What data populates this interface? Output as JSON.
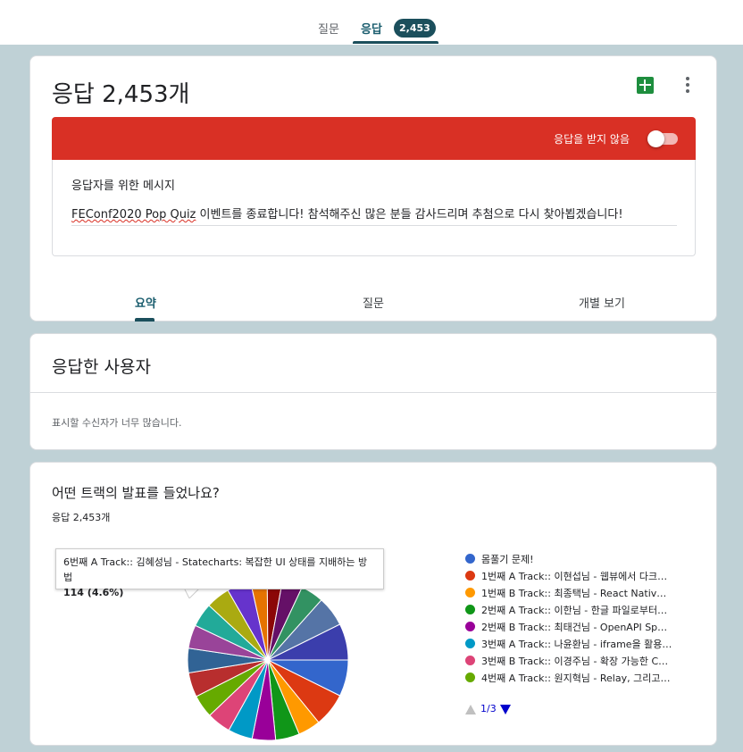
{
  "top_tabs": {
    "questions": "질문",
    "responses": "응답",
    "responses_count": "2,453"
  },
  "summary_card": {
    "title": "응답 2,453개",
    "accepting_label": "응답을 받지 않음",
    "accepting_responses": false,
    "message_label": "응답자를 위한 메시지",
    "message_misspelled_part": "FEConf2020 Pop Quiz",
    "message_rest": " 이벤트를 종료합니다! 참석해주신 많은 분들 감사드리며 추첨으로 다시 찾아뵙겠습니다!",
    "tabs": [
      "요약",
      "질문",
      "개별 보기"
    ],
    "active_tab": 0
  },
  "respondents_card": {
    "title": "응답한 사용자",
    "note": "표시할 수신자가 너무 많습니다."
  },
  "question_card": {
    "title": "어떤 트랙의 발표를 들었나요?",
    "count": "응답 2,453개",
    "tooltip": {
      "label": "6번째 A Track:: 김혜성님 - Statecharts: 복잡한 UI 상태를 지배하는 방법",
      "value": "114 (4.6%)"
    },
    "legend": [
      {
        "label": "몸풀기 문제!",
        "color": "#3366cc"
      },
      {
        "label": "1번째 A Track:: 이현섭님 - 웹뷰에서 다크…",
        "color": "#dc3912"
      },
      {
        "label": "1번째 B Track:: 최종택님 - React Native…",
        "color": "#ff9900"
      },
      {
        "label": "2번째 A Track:: 이한님 - 한글 파일로부터…",
        "color": "#109618"
      },
      {
        "label": "2번째 B Track:: 최태건님 - OpenAPI Sp…",
        "color": "#990099"
      },
      {
        "label": "3번째 A Track:: 나윤환님 - iframe을 활용…",
        "color": "#0099c6"
      },
      {
        "label": "3번째 B Track:: 이경주님 - 확장 가능한 C…",
        "color": "#dd4477"
      },
      {
        "label": "4번째 A Track:: 원지혁님 - Relay, 그리고…",
        "color": "#66aa00"
      }
    ],
    "pager": "1/3"
  },
  "chart_data": {
    "type": "pie",
    "title": "어떤 트랙의 발표를 들었나요?",
    "total": 2453,
    "slices": [
      {
        "label": "몸풀기 문제!",
        "value": 7.0,
        "color": "#3366cc"
      },
      {
        "label": "1번째 A Track:: 이현섭님 - 웹뷰에서 다크…",
        "value": 6.5,
        "color": "#dc3912"
      },
      {
        "label": "1번째 B Track:: 최종택님 - React Native…",
        "value": 4.3,
        "color": "#ff9900"
      },
      {
        "label": "2번째 A Track:: 이한님 - 한글 파일로부터…",
        "value": 4.6,
        "color": "#109618"
      },
      {
        "label": "2번째 B Track:: 최태건님 - OpenAPI Sp…",
        "value": 4.5,
        "color": "#990099"
      },
      {
        "label": "3번째 A Track:: 나윤환님 - iframe을 활용…",
        "value": 4.7,
        "color": "#0099c6"
      },
      {
        "label": "3번째 B Track:: 이경주님 - 확장 가능한 C…",
        "value": 4.6,
        "color": "#dd4477"
      },
      {
        "label": "4번째 A Track:: 원지혁님 - Relay, 그리고…",
        "value": 4.4,
        "color": "#66aa00"
      },
      {
        "label": "",
        "value": 4.7,
        "color": "#b82e2e"
      },
      {
        "label": "",
        "value": 4.7,
        "color": "#316395"
      },
      {
        "label": "",
        "value": 4.5,
        "color": "#994499"
      },
      {
        "label": "6번째 A Track:: 김혜성님 - Statecharts: 복잡한 UI 상태를 지배하는 방법",
        "value": 4.6,
        "color": "#22aa99"
      },
      {
        "label": "",
        "value": 4.6,
        "color": "#aaaa11"
      },
      {
        "label": "",
        "value": 4.6,
        "color": "#6633cc"
      },
      {
        "label": "",
        "value": 3.2,
        "color": "#e67300"
      },
      {
        "label": "",
        "value": 2.9,
        "color": "#8b0707"
      },
      {
        "label": "",
        "value": 3.9,
        "color": "#651067"
      },
      {
        "label": "",
        "value": 4.4,
        "color": "#329262"
      },
      {
        "label": "",
        "value": 5.8,
        "color": "#5574a6"
      },
      {
        "label": "",
        "value": 7.0,
        "color": "#3b3eac"
      }
    ]
  }
}
